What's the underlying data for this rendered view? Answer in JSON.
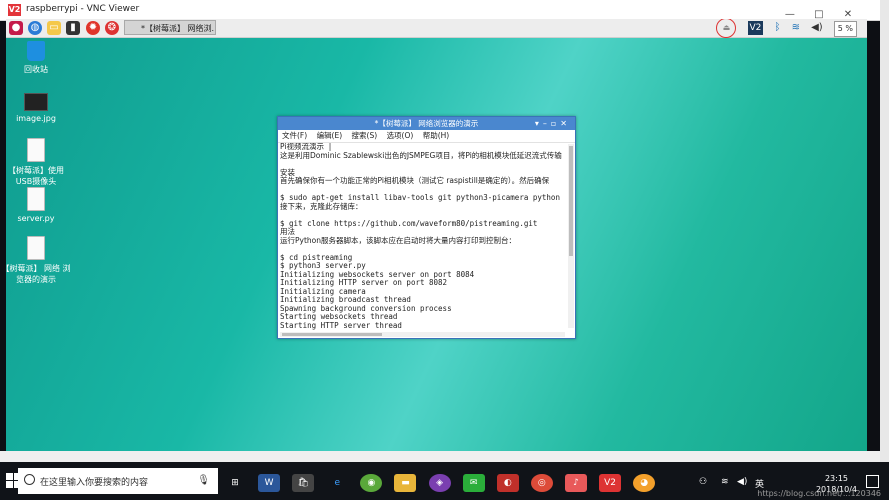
{
  "vnc": {
    "logo": "V2",
    "title": "raspberrypi - VNC Viewer",
    "controls": [
      "—",
      "□",
      "✕"
    ]
  },
  "pi_panel": {
    "task_label": "*【树莓派】 网络浏...",
    "tray_vnc": "V2",
    "tray_battery": "5 %"
  },
  "desktop_icons": [
    {
      "label": "回收站"
    },
    {
      "label": "image.jpg"
    },
    {
      "label": "【树莓派】使用 USB摄像头"
    },
    {
      "label": "server.py"
    },
    {
      "label": "【树莓派】 网络 浏览器的演示"
    }
  ],
  "window": {
    "title": "*【树莓派】 网络浏览器的演示",
    "menu": [
      "文件(F)",
      "编辑(E)",
      "搜索(S)",
      "选项(O)",
      "帮助(H)"
    ],
    "lines": [
      {
        "text": "Pi视频流演示  |",
        "mono": false
      },
      {
        "text": "这是利用Dominic Szablewski出色的JSMPEG项目，将Pi的相机模块低延迟流式传输",
        "mono": false
      },
      {
        "text": "",
        "mono": false
      },
      {
        "text": "安装",
        "mono": false
      },
      {
        "text": "首先确保你有一个功能正常的Pi相机模块（测试它 raspistill是确定的）。然后确保",
        "mono": false
      },
      {
        "text": "",
        "mono": false
      },
      {
        "text": "$ sudo apt-get install libav-tools git python3-picamera python",
        "mono": true
      },
      {
        "text": "接下来，克隆此存储库：",
        "mono": false
      },
      {
        "text": "",
        "mono": false
      },
      {
        "text": "$ git clone https://github.com/waveform80/pistreaming.git",
        "mono": true
      },
      {
        "text": "用法",
        "mono": false
      },
      {
        "text": "运行Python服务器脚本，该脚本应在启动时将大量内容打印到控制台：",
        "mono": false
      },
      {
        "text": "",
        "mono": false
      },
      {
        "text": "$ cd pistreaming",
        "mono": true
      },
      {
        "text": "$ python3 server.py",
        "mono": true
      },
      {
        "text": "Initializing websockets server on port 8084",
        "mono": true
      },
      {
        "text": "Initializing HTTP server on port 8082",
        "mono": true
      },
      {
        "text": "Initializing camera",
        "mono": true
      },
      {
        "text": "Initializing broadcast thread",
        "mono": true
      },
      {
        "text": "Spawning background conversion process",
        "mono": true
      },
      {
        "text": "Starting websockets thread",
        "mono": true
      },
      {
        "text": "Starting HTTP server thread",
        "mono": true
      }
    ]
  },
  "taskbar": {
    "search_placeholder": "在这里输入你要搜索的内容",
    "time": "23:15",
    "date": "2018/10/4",
    "ime": "英",
    "watermark": "https://blog.csdn.net/...120346"
  }
}
